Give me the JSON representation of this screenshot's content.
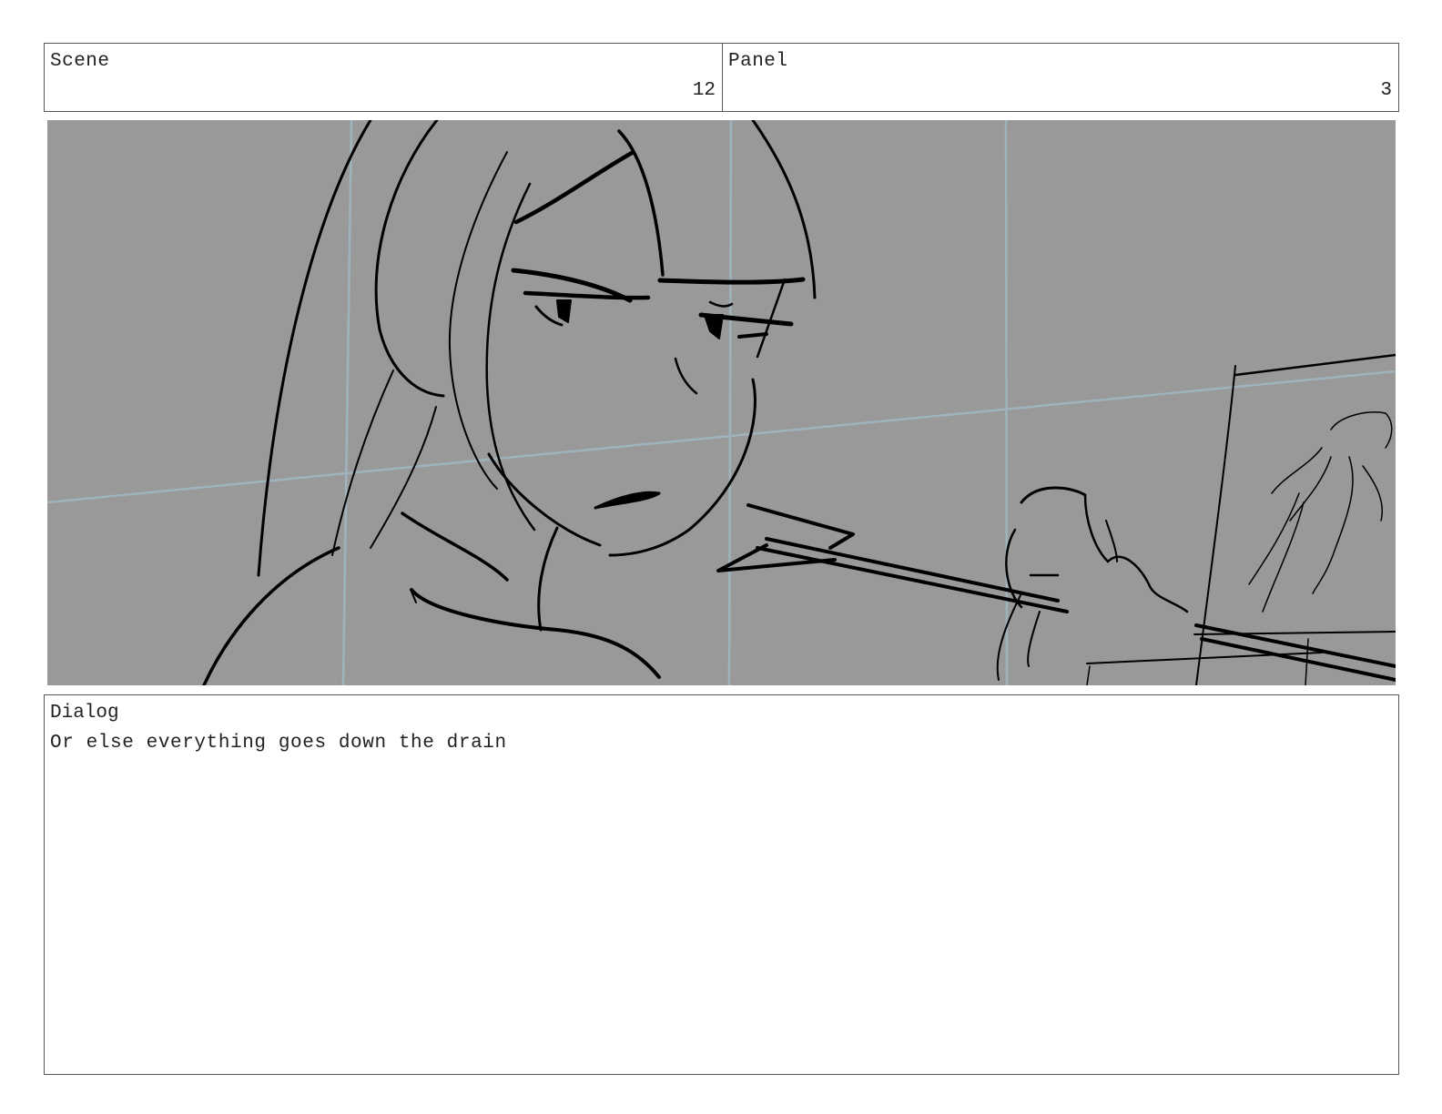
{
  "header": {
    "scene_label": "Scene",
    "scene_number": "12",
    "panel_label": "Panel",
    "panel_number": "3"
  },
  "sketch": {
    "description_icon": "storyboard-sketch-icon",
    "background_color": "#999999",
    "guide_color": "#9fb3bd",
    "line_color": "#000000"
  },
  "dialog": {
    "label": "Dialog",
    "text": "Or else everything goes down the drain"
  }
}
